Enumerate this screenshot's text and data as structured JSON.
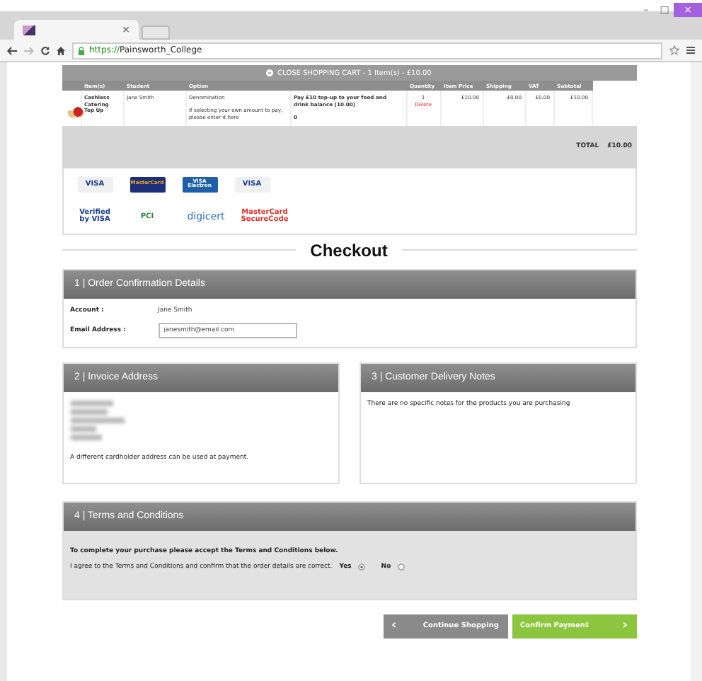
{
  "browser": {
    "tab_close": "×",
    "url_scheme": "https://",
    "url_host": "Painsworth_College",
    "window_buttons": [
      "–",
      "□",
      "×"
    ]
  },
  "cart_bar": {
    "text": "CLOSE SHOPPING CART - 1 Item(s) - £10.00"
  },
  "cart_table": {
    "columns": [
      "Item(s)",
      "Student",
      "Option",
      "",
      "Quantity",
      "Item Price",
      "Shipping",
      "VAT",
      "Subtotal"
    ],
    "rows": [
      {
        "item": "Cashless Catering Top Up",
        "student": "Jane Smith",
        "option_1": "Denomination",
        "option_2": "If selecting your own amount to pay, please enter it here",
        "value_1": "Pay £10 top-up to your food and drink balance (10.00)",
        "value_2": "0",
        "quantity": "1",
        "delete": "Delete",
        "price": "£10.00",
        "shipping": "£0.00",
        "vat": "£0.00",
        "subtotal": "£10.00"
      }
    ],
    "total_label": "TOTAL",
    "total_value": "£10.00"
  },
  "card_logos": [
    {
      "kind": "visa",
      "label": "VISA"
    },
    {
      "kind": "mastercard",
      "label": "MasterCard"
    },
    {
      "kind": "electron",
      "label": "VISA Electron"
    },
    {
      "kind": "debit",
      "label": "VISA"
    }
  ],
  "security_logos": [
    {
      "kind": "verified",
      "label": "Verified by VISA"
    },
    {
      "kind": "pci",
      "label": "PCI"
    },
    {
      "kind": "digicert",
      "label": "digicert"
    },
    {
      "kind": "securecode",
      "label": "MasterCard SecureCode"
    }
  ],
  "heading": "Checkout",
  "order_section": {
    "title": "1 | Order Confirmation Details",
    "account_label": "Account :",
    "account_value": "Jane Smith",
    "email_label": "Email Address :",
    "email_value": "janesmith@email.com"
  },
  "invoice_section": {
    "title": "2 | Invoice Address",
    "note": "A different cardholder address can be used at payment."
  },
  "notes_section": {
    "title": "3 | Customer Delivery Notes",
    "text": "There are no specific notes for the products you are purchasing"
  },
  "terms_section": {
    "title": "4 | Terms and Conditions",
    "intro": "To complete your purchase please accept the Terms and Conditions below.",
    "agree": "I agree to the Terms and Conditions and confirm that the order details are correct.",
    "options": [
      {
        "label": "Yes",
        "selected": true
      },
      {
        "label": "No",
        "selected": false
      }
    ]
  },
  "buttons": [
    {
      "kind": "back",
      "label": "Continue Shopping",
      "arrow": "‹"
    },
    {
      "kind": "confirm",
      "label": "Confirm Payment",
      "arrow": "›"
    }
  ]
}
